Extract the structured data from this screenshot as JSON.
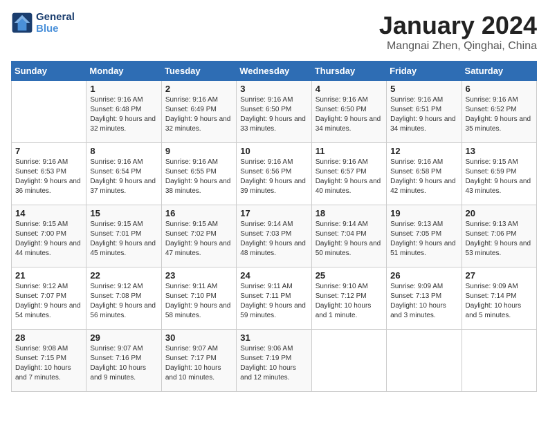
{
  "header": {
    "logo_line1": "General",
    "logo_line2": "Blue",
    "main_title": "January 2024",
    "subtitle": "Mangnai Zhen, Qinghai, China"
  },
  "days_of_week": [
    "Sunday",
    "Monday",
    "Tuesday",
    "Wednesday",
    "Thursday",
    "Friday",
    "Saturday"
  ],
  "weeks": [
    {
      "cells": [
        {
          "empty": true
        },
        {
          "day": "1",
          "sunrise": "9:16 AM",
          "sunset": "6:48 PM",
          "daylight": "9 hours and 32 minutes."
        },
        {
          "day": "2",
          "sunrise": "9:16 AM",
          "sunset": "6:49 PM",
          "daylight": "9 hours and 32 minutes."
        },
        {
          "day": "3",
          "sunrise": "9:16 AM",
          "sunset": "6:50 PM",
          "daylight": "9 hours and 33 minutes."
        },
        {
          "day": "4",
          "sunrise": "9:16 AM",
          "sunset": "6:50 PM",
          "daylight": "9 hours and 34 minutes."
        },
        {
          "day": "5",
          "sunrise": "9:16 AM",
          "sunset": "6:51 PM",
          "daylight": "9 hours and 34 minutes."
        },
        {
          "day": "6",
          "sunrise": "9:16 AM",
          "sunset": "6:52 PM",
          "daylight": "9 hours and 35 minutes."
        }
      ]
    },
    {
      "cells": [
        {
          "day": "7",
          "sunrise": "9:16 AM",
          "sunset": "6:53 PM",
          "daylight": "9 hours and 36 minutes."
        },
        {
          "day": "8",
          "sunrise": "9:16 AM",
          "sunset": "6:54 PM",
          "daylight": "9 hours and 37 minutes."
        },
        {
          "day": "9",
          "sunrise": "9:16 AM",
          "sunset": "6:55 PM",
          "daylight": "9 hours and 38 minutes."
        },
        {
          "day": "10",
          "sunrise": "9:16 AM",
          "sunset": "6:56 PM",
          "daylight": "9 hours and 39 minutes."
        },
        {
          "day": "11",
          "sunrise": "9:16 AM",
          "sunset": "6:57 PM",
          "daylight": "9 hours and 40 minutes."
        },
        {
          "day": "12",
          "sunrise": "9:16 AM",
          "sunset": "6:58 PM",
          "daylight": "9 hours and 42 minutes."
        },
        {
          "day": "13",
          "sunrise": "9:15 AM",
          "sunset": "6:59 PM",
          "daylight": "9 hours and 43 minutes."
        }
      ]
    },
    {
      "cells": [
        {
          "day": "14",
          "sunrise": "9:15 AM",
          "sunset": "7:00 PM",
          "daylight": "9 hours and 44 minutes."
        },
        {
          "day": "15",
          "sunrise": "9:15 AM",
          "sunset": "7:01 PM",
          "daylight": "9 hours and 45 minutes."
        },
        {
          "day": "16",
          "sunrise": "9:15 AM",
          "sunset": "7:02 PM",
          "daylight": "9 hours and 47 minutes."
        },
        {
          "day": "17",
          "sunrise": "9:14 AM",
          "sunset": "7:03 PM",
          "daylight": "9 hours and 48 minutes."
        },
        {
          "day": "18",
          "sunrise": "9:14 AM",
          "sunset": "7:04 PM",
          "daylight": "9 hours and 50 minutes."
        },
        {
          "day": "19",
          "sunrise": "9:13 AM",
          "sunset": "7:05 PM",
          "daylight": "9 hours and 51 minutes."
        },
        {
          "day": "20",
          "sunrise": "9:13 AM",
          "sunset": "7:06 PM",
          "daylight": "9 hours and 53 minutes."
        }
      ]
    },
    {
      "cells": [
        {
          "day": "21",
          "sunrise": "9:12 AM",
          "sunset": "7:07 PM",
          "daylight": "9 hours and 54 minutes."
        },
        {
          "day": "22",
          "sunrise": "9:12 AM",
          "sunset": "7:08 PM",
          "daylight": "9 hours and 56 minutes."
        },
        {
          "day": "23",
          "sunrise": "9:11 AM",
          "sunset": "7:10 PM",
          "daylight": "9 hours and 58 minutes."
        },
        {
          "day": "24",
          "sunrise": "9:11 AM",
          "sunset": "7:11 PM",
          "daylight": "9 hours and 59 minutes."
        },
        {
          "day": "25",
          "sunrise": "9:10 AM",
          "sunset": "7:12 PM",
          "daylight": "10 hours and 1 minute."
        },
        {
          "day": "26",
          "sunrise": "9:09 AM",
          "sunset": "7:13 PM",
          "daylight": "10 hours and 3 minutes."
        },
        {
          "day": "27",
          "sunrise": "9:09 AM",
          "sunset": "7:14 PM",
          "daylight": "10 hours and 5 minutes."
        }
      ]
    },
    {
      "cells": [
        {
          "day": "28",
          "sunrise": "9:08 AM",
          "sunset": "7:15 PM",
          "daylight": "10 hours and 7 minutes."
        },
        {
          "day": "29",
          "sunrise": "9:07 AM",
          "sunset": "7:16 PM",
          "daylight": "10 hours and 9 minutes."
        },
        {
          "day": "30",
          "sunrise": "9:07 AM",
          "sunset": "7:17 PM",
          "daylight": "10 hours and 10 minutes."
        },
        {
          "day": "31",
          "sunrise": "9:06 AM",
          "sunset": "7:19 PM",
          "daylight": "10 hours and 12 minutes."
        },
        {
          "empty": true
        },
        {
          "empty": true
        },
        {
          "empty": true
        }
      ]
    }
  ],
  "labels": {
    "sunrise": "Sunrise:",
    "sunset": "Sunset:",
    "daylight": "Daylight:"
  }
}
